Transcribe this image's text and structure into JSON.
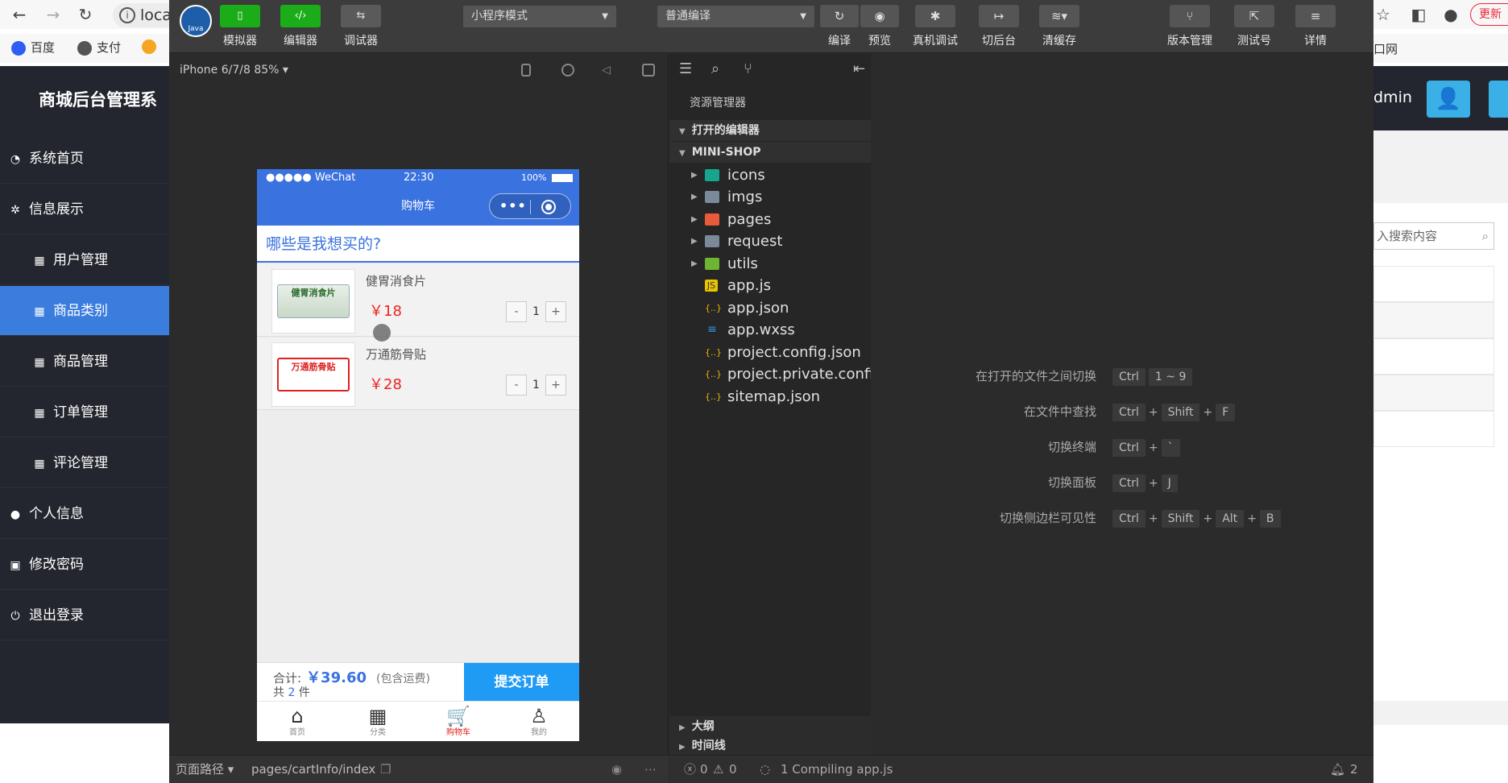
{
  "browser": {
    "address": "loca",
    "bookmarks": [
      "百度",
      "支付"
    ],
    "right_bookmark": "口网",
    "update_label": "更新",
    "admin_text": "dmin",
    "search_placeholder": "入搜索内容"
  },
  "admin": {
    "title": "商城后台管理系",
    "menu": [
      {
        "label": "系统首页",
        "icon": "dashboard-icon"
      },
      {
        "label": "信息展示",
        "icon": "cluster-icon"
      },
      {
        "label": "用户管理",
        "icon": "table-icon"
      },
      {
        "label": "商品类别",
        "icon": "table-icon"
      },
      {
        "label": "商品管理",
        "icon": "table-icon"
      },
      {
        "label": "订单管理",
        "icon": "table-icon"
      },
      {
        "label": "评论管理",
        "icon": "table-icon"
      },
      {
        "label": "个人信息",
        "icon": "user-icon"
      },
      {
        "label": "修改密码",
        "icon": "lock-icon"
      },
      {
        "label": "退出登录",
        "icon": "power-icon"
      }
    ],
    "active_item": "商品类别"
  },
  "devtools": {
    "logo_text": "Java",
    "toolbar": {
      "simulator": "模拟器",
      "editor": "编辑器",
      "debugger": "调试器",
      "mode_select": "小程序模式",
      "compile_select": "普通编译",
      "compile": "编译",
      "preview": "预览",
      "real_debug": "真机调试",
      "background": "切后台",
      "clear_cache": "清缓存",
      "version": "版本管理",
      "test_account": "测试号",
      "details": "详情"
    },
    "device": "iPhone 6/7/8 85% ▾",
    "page_path_label": "页面路径 ▾",
    "page_path": "pages/cartInfo/index",
    "status": {
      "errors": "0",
      "warnings": "0",
      "compiling": "1 Compiling app.js",
      "notifications": "2"
    }
  },
  "phone": {
    "carrier": "●●●●● WeChat",
    "time": "22:30",
    "battery": "100%",
    "nav_title": "购物车",
    "question": "哪些是我想买的?",
    "items": [
      {
        "name": "健胃消食片",
        "price": "￥18",
        "qty": "1",
        "thumb_text": "健胃消食片"
      },
      {
        "name": "万通筋骨贴",
        "price": "￥28",
        "qty": "1",
        "thumb_text": "万通筋骨贴"
      }
    ],
    "total_label": "合计:",
    "total": "￥39.60",
    "total_note": "(包含运费)",
    "count_prefix": "共",
    "count": "2",
    "count_suffix": "件",
    "submit": "提交订单",
    "tabs": [
      {
        "label": "首页",
        "icon": "home-icon"
      },
      {
        "label": "分类",
        "icon": "grid-icon"
      },
      {
        "label": "购物车",
        "icon": "cart-icon"
      },
      {
        "label": "我的",
        "icon": "person-icon"
      }
    ]
  },
  "explorer": {
    "title": "资源管理器",
    "open_editors": "打开的编辑器",
    "project": "MINI-SHOP",
    "tree": [
      {
        "name": "icons",
        "type": "folder"
      },
      {
        "name": "imgs",
        "type": "folder"
      },
      {
        "name": "pages",
        "type": "folder"
      },
      {
        "name": "request",
        "type": "folder"
      },
      {
        "name": "utils",
        "type": "folder"
      },
      {
        "name": "app.js",
        "type": "js"
      },
      {
        "name": "app.json",
        "type": "json"
      },
      {
        "name": "app.wxss",
        "type": "wxss"
      },
      {
        "name": "project.config.json",
        "type": "json"
      },
      {
        "name": "project.private.config...",
        "type": "json"
      },
      {
        "name": "sitemap.json",
        "type": "json"
      }
    ],
    "outline": "大纲",
    "timeline": "时间线"
  },
  "hints": [
    {
      "label": "在打开的文件之间切换",
      "keys": [
        "Ctrl",
        "1 ~ 9"
      ]
    },
    {
      "label": "在文件中查找",
      "keys": [
        "Ctrl",
        "Shift",
        "F"
      ]
    },
    {
      "label": "切换终端",
      "keys": [
        "Ctrl",
        "`"
      ]
    },
    {
      "label": "切换面板",
      "keys": [
        "Ctrl",
        "J"
      ]
    },
    {
      "label": "切换侧边栏可见性",
      "keys": [
        "Ctrl",
        "Shift",
        "Alt",
        "B"
      ]
    }
  ],
  "colors": {
    "wechat_blue": "#3a72e0",
    "submit_blue": "#1f9af5",
    "price_red": "#e22222",
    "admin_sidebar": "#23262e",
    "admin_active": "#3b7ddd"
  }
}
